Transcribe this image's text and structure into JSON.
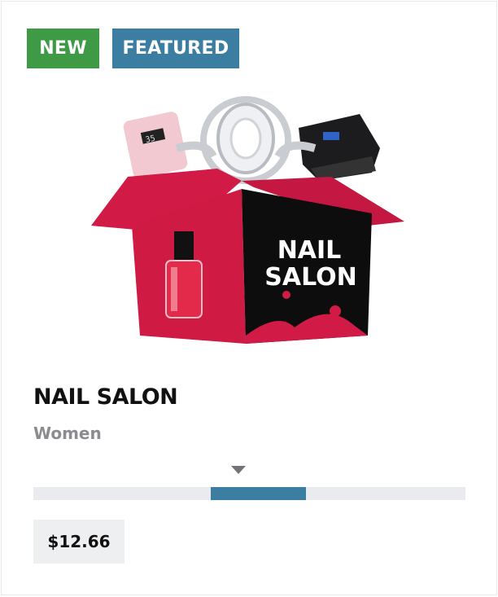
{
  "badges": {
    "new": {
      "label": "NEW",
      "color": "#3e9a45"
    },
    "featured": {
      "label": "FEATURED",
      "color": "#3c7ea1"
    }
  },
  "product": {
    "image_icon": "nail-salon-box-image",
    "box_text": [
      "NAIL",
      "SALON"
    ],
    "device_display": "35",
    "title": "NAIL SALON",
    "category": "Women",
    "price": "$12.66"
  },
  "range_bar": {
    "segment_start_fraction": 0.41,
    "segment_end_fraction": 0.63,
    "fill_color": "#3c7ea1",
    "track_color": "#e9ebee"
  }
}
